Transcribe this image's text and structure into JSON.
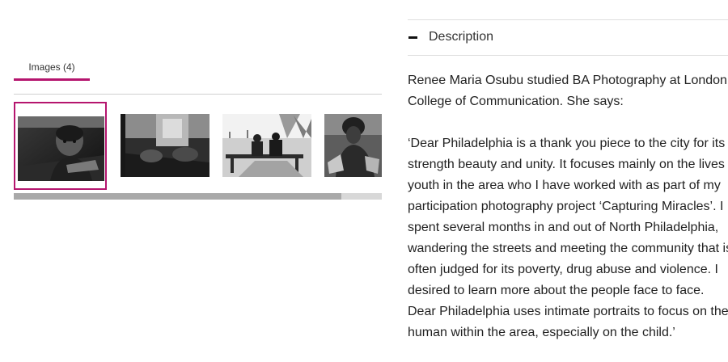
{
  "gallery": {
    "tab_label": "Images (4)",
    "thumbnails": [
      {
        "name": "thumbnail-boy-portrait",
        "selected": true
      },
      {
        "name": "thumbnail-figures-lying-down",
        "selected": false
      },
      {
        "name": "thumbnail-people-on-bench",
        "selected": false
      },
      {
        "name": "thumbnail-woman-portrait",
        "selected": false
      }
    ],
    "scroll_fraction": 0.89
  },
  "description": {
    "title": "Description",
    "toggle_icon": "minus-icon",
    "paragraph1": [
      "Renee Maria Osubu studied BA Photography at London",
      "College of Communication. She says:"
    ],
    "paragraph2": [
      "‘Dear Philadelphia is a thank you piece to the city for its",
      "strength beauty and unity. It focuses mainly on the lives of",
      "youth in the area who I have worked with as part of my",
      "participation photography project ‘Capturing Miracles’. I",
      "spent several months in and out of North Philadelphia,",
      "wandering the streets and meeting the community that is",
      "often judged for its poverty, drug abuse and violence. I",
      "desired to learn more about the people face to face.",
      "Dear Philadelphia uses intimate portraits to focus on the",
      "human within the area, especially on the child.’"
    ]
  },
  "colors": {
    "accent": "#b5156e",
    "rule": "#cfcfcf",
    "scroll_track": "#d8d8d8",
    "scroll_thumb": "#a9a9a9"
  }
}
